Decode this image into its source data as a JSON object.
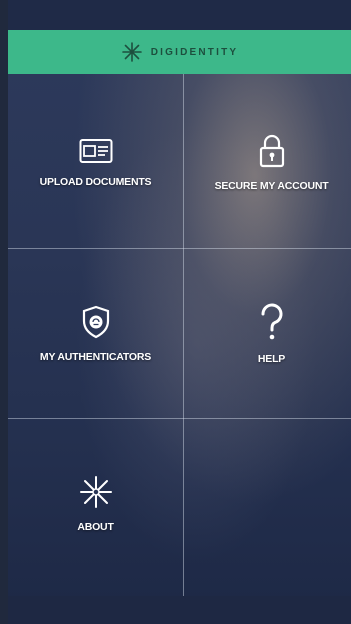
{
  "app": {
    "brand_name": "DIGIDENTITY",
    "accent_color": "#3db88a"
  },
  "menu": {
    "tiles": [
      {
        "label": "UPLOAD DOCUMENTS",
        "icon": "id-card-icon"
      },
      {
        "label": "SECURE MY ACCOUNT",
        "icon": "padlock-icon"
      },
      {
        "label": "MY AUTHENTICATORS",
        "icon": "shield-icon"
      },
      {
        "label": "HELP",
        "icon": "question-mark-icon"
      },
      {
        "label": "ABOUT",
        "icon": "digidentity-logo-icon"
      }
    ]
  }
}
